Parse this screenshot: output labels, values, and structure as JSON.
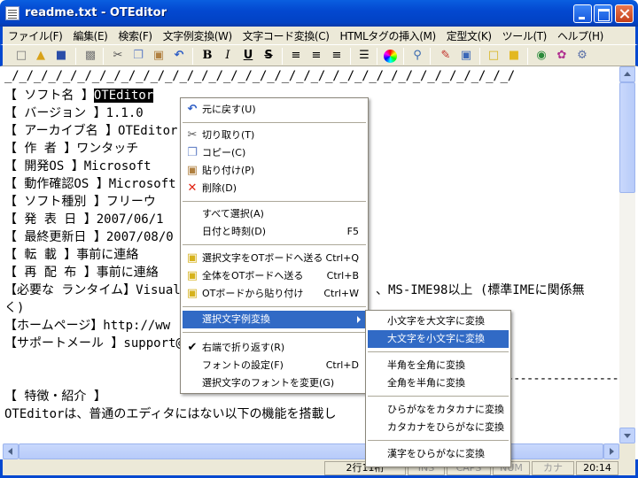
{
  "window": {
    "title": "readme.txt - OTEditor"
  },
  "menubar": [
    "ファイル(F)",
    "編集(E)",
    "検索(F)",
    "文字例変換(W)",
    "文字コード変換(C)",
    "HTMLタグの挿入(M)",
    "定型文(K)",
    "ツール(T)",
    "ヘルプ(H)"
  ],
  "toolbar_icons": [
    "new-file-icon",
    "open-folder-icon",
    "save-icon",
    "print-icon",
    "cut-icon",
    "copy-icon",
    "paste-icon",
    "undo-icon",
    "bold-icon",
    "italic-icon",
    "underline-icon",
    "strikethrough-icon",
    "align-left-icon",
    "align-center-icon",
    "align-right-icon",
    "list-icon",
    "color-wheel-icon",
    "search-icon",
    "pdf-icon",
    "window-icon",
    "new-doc-icon",
    "folder-icon",
    "globe-icon",
    "palette-icon",
    "settings-icon"
  ],
  "editor": {
    "lines": [
      "_/_/_/_/_/_/_/_/_/_/_/_/_/_/_/_/_/_/_/_/_/_/_/_/_/_/_/_/_/_/_/_/_/_/_/",
      "【  ソフト名  】",
      "【  バージョン  】1.1.0",
      "【 アーカイブ名 】OTEditor",
      "【  作    者  】ワンタッチ",
      "【   開発OS   】Microsoft",
      "【 動作確認OS 】Microsoft",
      "【 ソフト種別 】フリーウ",
      "【  発 表 日  】2007/06/1",
      "【 最終更新日 】2007/08/0",
      "【  転    載  】事前に連絡",
      "【  再 配 布  】事前に連絡",
      "【必要な ランタイム】Visual Ba",
      "く)",
      "【ホームページ】http://ww",
      "【サポートメール 】support@o",
      "",
      "",
      "【 特徴・紹介 】",
      "OTEditorは、普通のエディタにはない以下の機能を搭載し"
    ],
    "selected_text": "OTEditor",
    "runtime_tail": "、MS-IME98以上 (標準IMEに関係無",
    "dash_line": "--------------------------------------------------------------------------"
  },
  "context_menu": {
    "items": [
      {
        "label": "元に戻す(U)",
        "shortcut": "",
        "icon": "undo-icon"
      },
      {
        "label": "切り取り(T)",
        "shortcut": "",
        "icon": "cut-icon"
      },
      {
        "label": "コピー(C)",
        "shortcut": "",
        "icon": "copy-icon"
      },
      {
        "label": "貼り付け(P)",
        "shortcut": "",
        "icon": "paste-icon"
      },
      {
        "label": "削除(D)",
        "shortcut": "",
        "icon": "delete-icon"
      },
      {
        "label": "すべて選択(A)",
        "shortcut": "",
        "icon": ""
      },
      {
        "label": "日付と時刻(D)",
        "shortcut": "F5",
        "icon": ""
      },
      {
        "label": "選択文字をOTボードへ送る",
        "shortcut": "Ctrl+Q",
        "icon": "board-icon"
      },
      {
        "label": "全体をOTボードへ送る",
        "shortcut": "Ctrl+B",
        "icon": "board-icon"
      },
      {
        "label": "OTボードから貼り付け",
        "shortcut": "Ctrl+W",
        "icon": "board-icon"
      },
      {
        "label": "選択文字例変換",
        "shortcut": "",
        "icon": ""
      },
      {
        "label": "右端で折り返す(R)",
        "shortcut": "",
        "icon": "check-icon"
      },
      {
        "label": "フォントの設定(F)",
        "shortcut": "Ctrl+D",
        "icon": ""
      },
      {
        "label": "選択文字のフォントを変更(G)",
        "shortcut": "",
        "icon": ""
      }
    ]
  },
  "submenu": {
    "items": [
      "小文字を大文字に変換",
      "大文字を小文字に変換",
      "半角を全角に変換",
      "全角を半角に変換",
      "ひらがなをカタカナに変換",
      "カタカナをひらがなに変換",
      "漢字をひらがなに変換"
    ]
  },
  "statusbar": {
    "position": "2行11桁",
    "ins": "INS",
    "caps": "CAPS",
    "num": "NUM",
    "kana": "カナ",
    "time": "20:14"
  }
}
